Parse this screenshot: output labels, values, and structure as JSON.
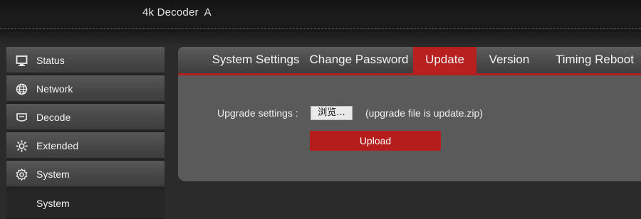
{
  "header": {
    "title": "4k Decoder  A"
  },
  "sidebar": {
    "items": [
      {
        "label": "Status",
        "icon": "monitor-icon"
      },
      {
        "label": "Network",
        "icon": "globe-icon"
      },
      {
        "label": "Decode",
        "icon": "display-icon"
      },
      {
        "label": "Extended",
        "icon": "sun-gear-icon"
      },
      {
        "label": "System",
        "icon": "gear-icon"
      }
    ],
    "sub_items": [
      {
        "label": "System"
      }
    ]
  },
  "tabs": {
    "items": [
      {
        "label": "System Settings"
      },
      {
        "label": "Change Password"
      },
      {
        "label": "Update"
      },
      {
        "label": "Version"
      },
      {
        "label": "Timing Reboot"
      }
    ],
    "active": "Update"
  },
  "update": {
    "settings_label": "Upgrade settings :",
    "browse_label": "浏览...",
    "hint": "(upgrade file is update.zip)",
    "upload_label": "Upload"
  },
  "colors": {
    "accent": "#b81f1f",
    "panel": "#5a5a5a",
    "background": "#2b2b2b"
  }
}
